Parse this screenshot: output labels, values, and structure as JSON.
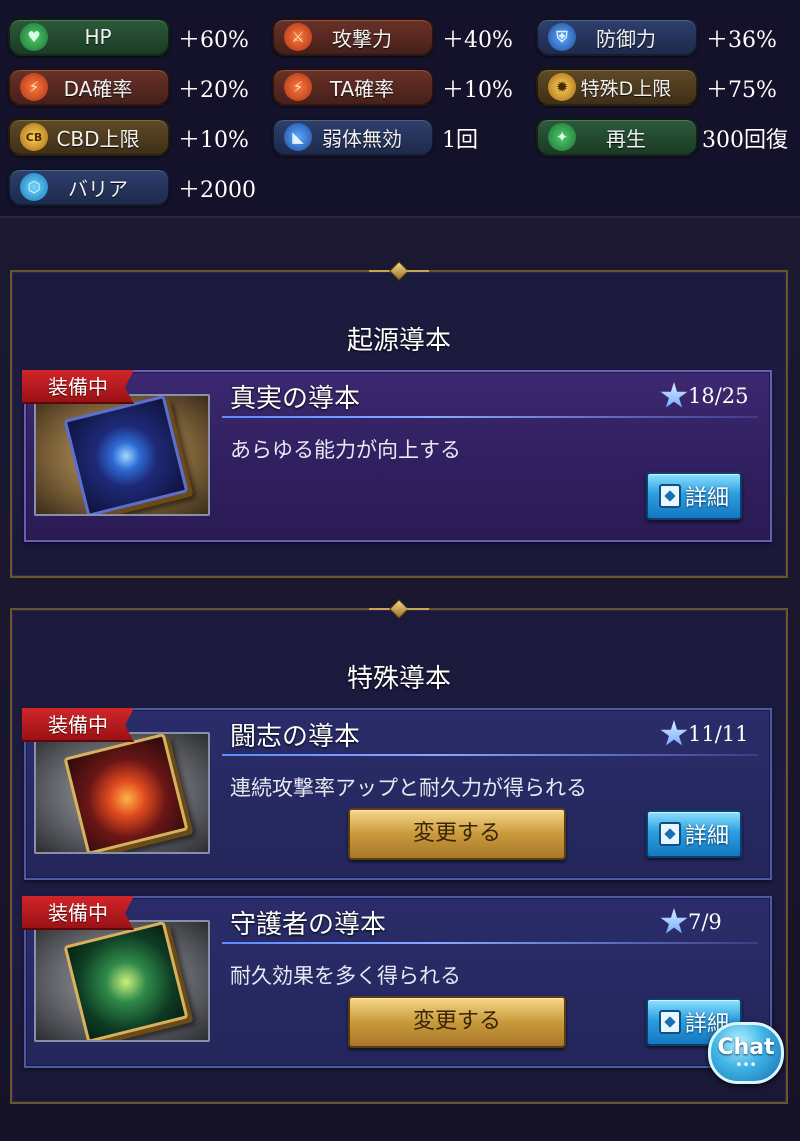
{
  "stats": [
    {
      "label": "HP",
      "value": "＋60%",
      "icon": "heart-icon",
      "theme": "green",
      "glyph": "♥"
    },
    {
      "label": "攻撃力",
      "value": "＋40%",
      "icon": "sword-icon",
      "theme": "red",
      "glyph": "⚔"
    },
    {
      "label": "防御力",
      "value": "＋36%",
      "icon": "shield-icon",
      "theme": "blue",
      "glyph": "⛨"
    },
    {
      "label": "DA確率",
      "value": "＋20%",
      "icon": "double-attack-icon",
      "theme": "red",
      "glyph": "⚡"
    },
    {
      "label": "TA確率",
      "value": "＋10%",
      "icon": "triple-attack-icon",
      "theme": "red",
      "glyph": "⚡"
    },
    {
      "label": "特殊D上限",
      "value": "＋75%",
      "icon": "special-damage-icon",
      "theme": "gold",
      "glyph": "✹"
    },
    {
      "label": "CBD上限",
      "value": "＋10%",
      "icon": "chain-burst-icon",
      "theme": "gold",
      "glyph": "CB"
    },
    {
      "label": "弱体無効",
      "value": "1回",
      "icon": "debuff-immunity-icon",
      "theme": "blue",
      "glyph": "◣"
    },
    {
      "label": "再生",
      "value": "300回復",
      "icon": "regen-icon",
      "theme": "green",
      "glyph": "✦"
    },
    {
      "label": "バリア",
      "value": "＋2000",
      "icon": "barrier-icon",
      "theme": "blue",
      "glyph": "⬡"
    }
  ],
  "sections": {
    "origin": {
      "title": "起源導本",
      "card": {
        "badge": "装備中",
        "name": "真実の導本",
        "rank": "18/25",
        "desc": "あらゆる能力が向上する",
        "detail_label": "詳細"
      }
    },
    "special": {
      "title": "特殊導本",
      "cards": [
        {
          "badge": "装備中",
          "name": "闘志の導本",
          "rank": "11/11",
          "desc": "連続攻撃率アップと耐久力が得られる",
          "change_label": "変更する",
          "detail_label": "詳細"
        },
        {
          "badge": "装備中",
          "name": "守護者の導本",
          "rank": "7/9",
          "desc": "耐久効果を多く得られる",
          "change_label": "変更する",
          "detail_label": "詳細"
        }
      ]
    }
  },
  "chat": {
    "label": "Chat",
    "dots": "•••"
  },
  "colors": {
    "accent_gold": "#c9a455",
    "badge_red": "#d1262a",
    "detail_blue": "#2c9fe0"
  }
}
